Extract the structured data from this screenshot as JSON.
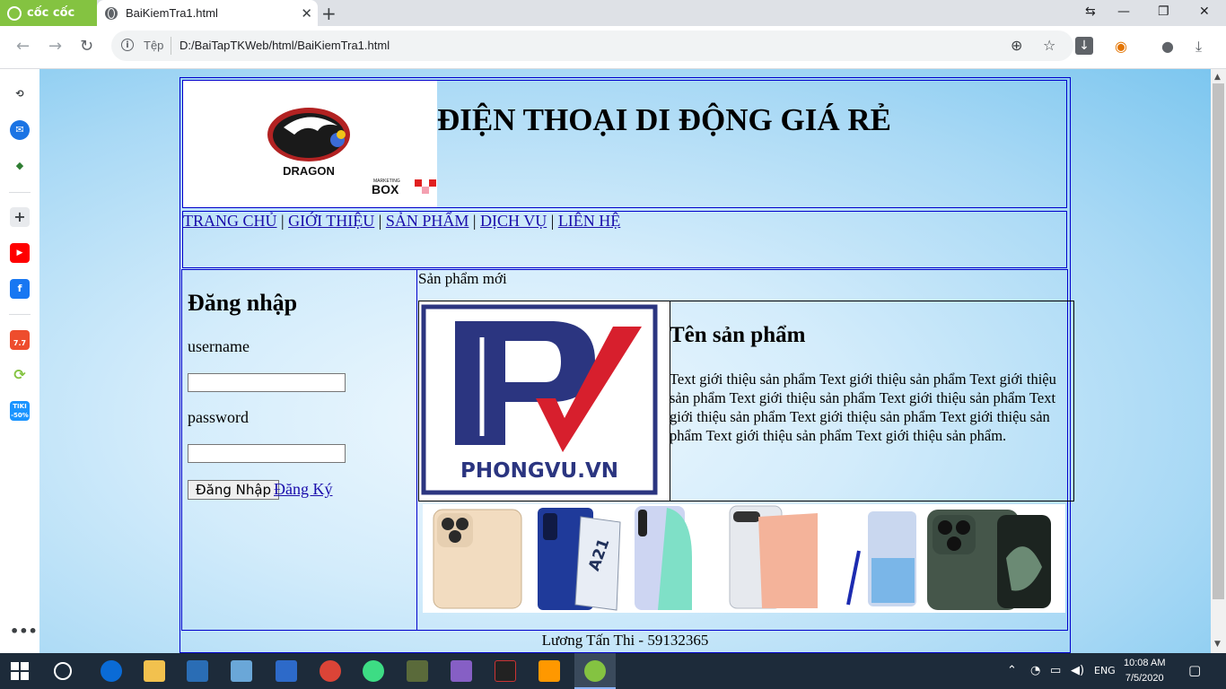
{
  "browser": {
    "brand": "cốc cốc",
    "tab_title": "BaiKiemTra1.html",
    "scheme_label": "Tệp",
    "url": "D:/BaiTapTKWeb/html/BaiKiemTra1.html"
  },
  "page": {
    "header_title": "ĐIỆN THOẠI DI ĐỘNG GIÁ RẺ",
    "logo": {
      "main": "DRAGON",
      "badge_small": "MARKETING",
      "badge_big": "BOX"
    },
    "menu": [
      "TRANG CHỦ",
      "GIỚI THIỆU",
      "SẢN PHẨM",
      "DỊCH VỤ",
      "LIÊN HỆ"
    ],
    "menu_separator": "|",
    "login": {
      "heading": "Đăng nhập",
      "username_label": "username",
      "password_label": "password",
      "login_button": "Đăng Nhập",
      "register_link": "Đăng Ký"
    },
    "section_title": "Sản phẩm mới",
    "product": {
      "image_brand": "PHONGVU.VN",
      "name": "Tên sản phẩm",
      "description": "Text giới thiệu sản phẩm Text giới thiệu sản phẩm Text giới thiệu sản phẩm Text giới thiệu sản phẩm Text giới thiệu sản phẩm Text giới thiệu sản phẩm Text giới thiệu sản phẩm Text giới thiệu sản phẩm Text giới thiệu sản phẩm Text giới thiệu sản phẩm."
    },
    "phones_banner_text": "A21",
    "footer": "Lương Tấn Thi - 59132365"
  },
  "sidebar": {
    "shopee_badge": "7.7",
    "tiki_badge": "TIKI -50%"
  },
  "taskbar": {
    "language": "ENG",
    "time": "10:08 AM",
    "date": "7/5/2020"
  },
  "colors": {
    "border": "#0000cc",
    "link": "#1a0dab",
    "accent": "#84c341",
    "pv_navy": "#2b3580",
    "pv_red": "#d71f2d"
  }
}
